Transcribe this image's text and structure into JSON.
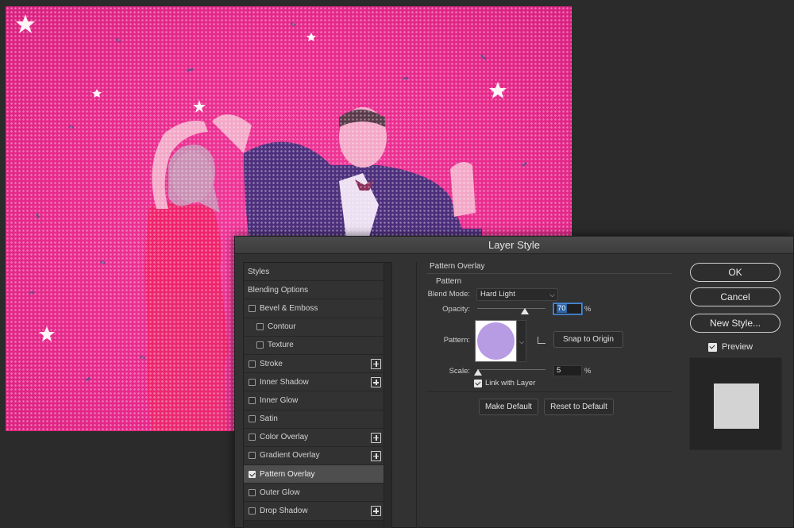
{
  "dialog": {
    "title": "Layer Style",
    "styles_list": [
      {
        "label": "Styles",
        "kind": "header",
        "checked": false,
        "plus": false
      },
      {
        "label": "Blending Options",
        "kind": "header",
        "checked": false,
        "plus": false
      },
      {
        "label": "Bevel & Emboss",
        "kind": "item",
        "checked": false,
        "plus": false
      },
      {
        "label": "Contour",
        "kind": "sub",
        "checked": false,
        "plus": false
      },
      {
        "label": "Texture",
        "kind": "sub",
        "checked": false,
        "plus": false
      },
      {
        "label": "Stroke",
        "kind": "item",
        "checked": false,
        "plus": true
      },
      {
        "label": "Inner Shadow",
        "kind": "item",
        "checked": false,
        "plus": true
      },
      {
        "label": "Inner Glow",
        "kind": "item",
        "checked": false,
        "plus": false
      },
      {
        "label": "Satin",
        "kind": "item",
        "checked": false,
        "plus": false
      },
      {
        "label": "Color Overlay",
        "kind": "item",
        "checked": false,
        "plus": true
      },
      {
        "label": "Gradient Overlay",
        "kind": "item",
        "checked": false,
        "plus": true
      },
      {
        "label": "Pattern Overlay",
        "kind": "item",
        "checked": true,
        "plus": false,
        "selected": true
      },
      {
        "label": "Outer Glow",
        "kind": "item",
        "checked": false,
        "plus": false
      },
      {
        "label": "Drop Shadow",
        "kind": "item",
        "checked": false,
        "plus": true
      }
    ],
    "panel": {
      "title": "Pattern Overlay",
      "group_label": "Pattern",
      "blend_mode_label": "Blend Mode:",
      "blend_mode_value": "Hard Light",
      "opacity_label": "Opacity:",
      "opacity_value": "70",
      "opacity_unit": "%",
      "opacity_fraction": 0.7,
      "pattern_label": "Pattern:",
      "pattern_color": "#b79be3",
      "snap_button": "Snap to Origin",
      "scale_label": "Scale:",
      "scale_value": "5",
      "scale_unit": "%",
      "link_label": "Link with Layer",
      "link_checked": true,
      "make_default": "Make Default",
      "reset_default": "Reset to Default"
    },
    "buttons": {
      "ok": "OK",
      "cancel": "Cancel",
      "new_style": "New Style..."
    },
    "preview": {
      "label": "Preview",
      "checked": true
    }
  },
  "colors": {
    "canvas_pink": "#e82a8c",
    "pattern_dot": "#b79be3",
    "accent_blue": "#2f63a8"
  }
}
